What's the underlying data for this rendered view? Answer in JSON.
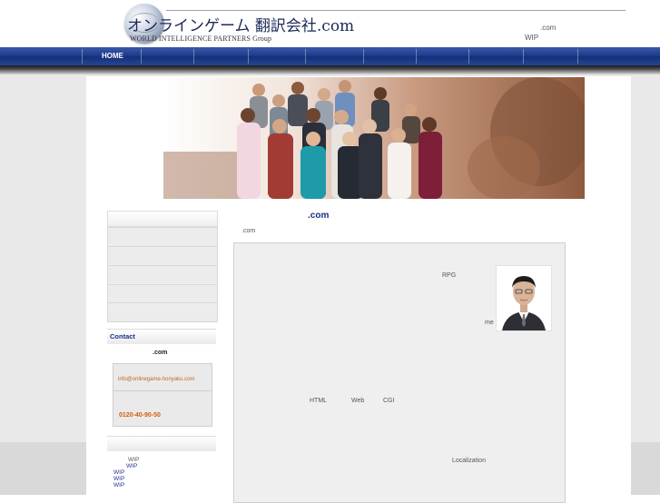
{
  "header": {
    "logo_title": "オンラインゲーム 翻訳会社.com",
    "logo_subtitle": "WORLD INTELLIGENCE PARTNERS Group",
    "domain": ".com",
    "wip": "WIP"
  },
  "nav": {
    "home": "HOME"
  },
  "sidebar": {
    "contact_title": "Contact",
    "contact_domain": ".com",
    "email": "info@onlinegame-honyaku.com",
    "phone": "0120-40-90-50",
    "links": [
      "WIP",
      "WIP",
      "WIP",
      "WIP",
      "WIP"
    ]
  },
  "main": {
    "title": ".com",
    "subtitle": ".com",
    "rpg": "RPG",
    "me": "me",
    "html": "HTML",
    "web": "Web",
    "cgi": "CGI",
    "localization": "Localization"
  },
  "colors": {
    "nav_blue": "#1f3c8c",
    "title_blue": "#1b2d86",
    "contact_orange": "#d45e10"
  },
  "icons": {
    "logo": "globe-logo-icon"
  }
}
